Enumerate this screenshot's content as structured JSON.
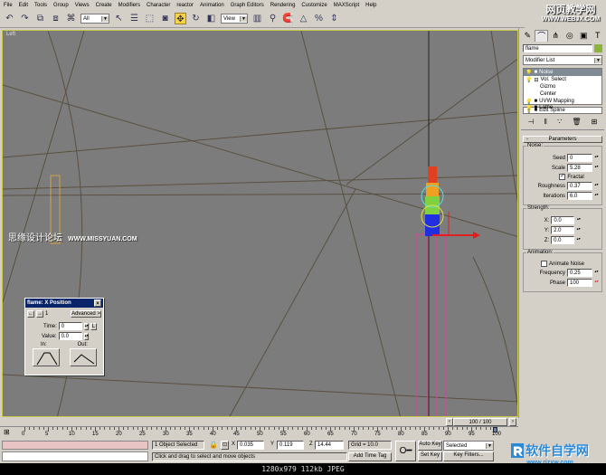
{
  "menu": [
    "File",
    "Edit",
    "Tools",
    "Group",
    "Views",
    "Create",
    "Modifiers",
    "Character",
    "reactor",
    "Animation",
    "Graph Editors",
    "Rendering",
    "Customize",
    "MAXScript",
    "Help"
  ],
  "toolbar": {
    "selection_filter": "All",
    "reference_coord": "View"
  },
  "viewport": {
    "label": "Left",
    "watermark_cn": "思缘设计论坛",
    "watermark_url": "WWW.MISSYUAN.COM"
  },
  "watermark_top": {
    "cn": "网页教学网",
    "url": "WWW.WEBJX.COM"
  },
  "watermark_bottom": {
    "cn": "软件自学网",
    "url": "www.rjzxw.com"
  },
  "dialog": {
    "title": "flame: X Position",
    "key_number": "1",
    "advanced": "Advanced >",
    "time_label": "Time:",
    "time_value": "0",
    "lock": "L",
    "value_label": "Value:",
    "value_value": "0.0",
    "in_label": "In:",
    "out_label": "Out:"
  },
  "command_panel": {
    "object_name": "flame",
    "object_color": "#8ab43a",
    "modifier_list": "Modifier List",
    "stack": [
      {
        "label": "Noise",
        "selected": true,
        "indent": 0
      },
      {
        "label": "Vol. Select",
        "selected": false,
        "indent": 0
      },
      {
        "label": "Gizmo",
        "selected": false,
        "indent": 1
      },
      {
        "label": "Center",
        "selected": false,
        "indent": 1
      },
      {
        "label": "UVW Mapping",
        "selected": false,
        "indent": 0
      },
      {
        "label": "Lathe",
        "selected": false,
        "indent": 0
      },
      {
        "label": "Edit Spline",
        "selected": false,
        "indent": 0
      }
    ],
    "rollout": "Parameters",
    "noise": {
      "title": "Noise:",
      "seed_label": "Seed",
      "seed": "0",
      "scale_label": "Scale",
      "scale": "5.28",
      "fractal_label": "Fractal",
      "fractal": true,
      "roughness_label": "Roughness",
      "roughness": "0.37",
      "iterations_label": "Iterations",
      "iterations": "6.0"
    },
    "strength": {
      "title": "Strength:",
      "x_label": "X:",
      "x": "0.0",
      "y_label": "Y:",
      "y": "2.0",
      "z_label": "Z:",
      "z": "0.0"
    },
    "animation": {
      "title": "Animation:",
      "animate_label": "Animate Noise",
      "animate": false,
      "frequency_label": "Frequency",
      "frequency": "0.25",
      "phase_label": "Phase",
      "phase": "100"
    }
  },
  "timeline": {
    "frame_display": "100 / 100",
    "ticks": [
      "0",
      "5",
      "10",
      "15",
      "20",
      "25",
      "30",
      "35",
      "40",
      "45",
      "50",
      "55",
      "60",
      "65",
      "70",
      "75",
      "80",
      "85",
      "90",
      "95",
      "100"
    ],
    "current_frame": 100,
    "total_frames": 100
  },
  "status": {
    "selection": "1 Object Selected",
    "x_label": "X",
    "x": "0.035",
    "y_label": "Y",
    "y": "0.119",
    "z_label": "Z",
    "z": "14.44",
    "grid": "Grid = 10.0",
    "prompt": "Click and drag to select and move objects",
    "add_time_tag": "Add Time Tag",
    "auto_key": "Auto Key",
    "set_key": "Set Key",
    "key_mode": "Selected",
    "key_filters": "Key Filters..."
  },
  "caption": "1280x979  112kb  JPEG"
}
